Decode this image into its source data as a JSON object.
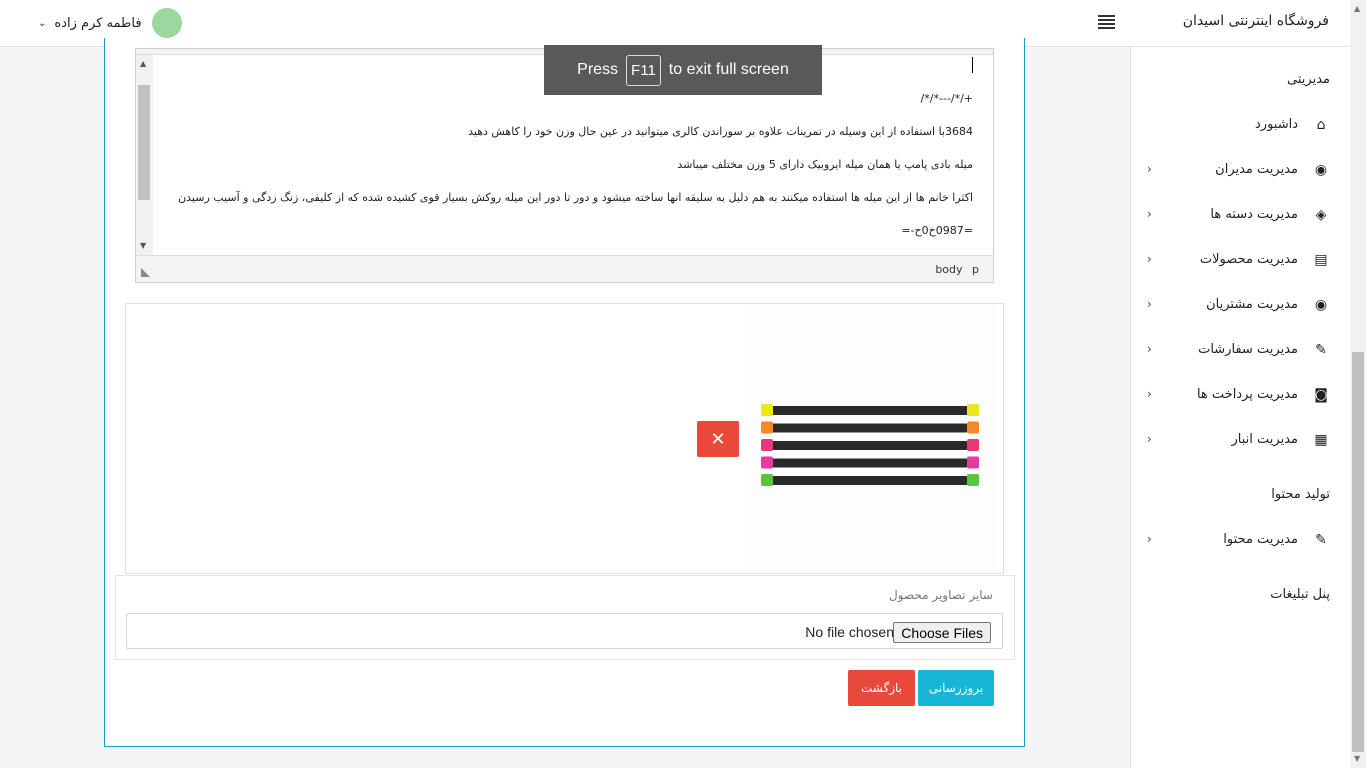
{
  "header": {
    "brand": "فروشگاه اینترنتی اسیدان",
    "user_name": "فاطمه کرم زاده",
    "user_chevron": "⌄"
  },
  "fullscreen_toast": {
    "press": "Press",
    "key": "F11",
    "rest": "to exit full screen"
  },
  "editor": {
    "lines": [
      "+/*/---*/*/",
      "3684با استفاده از این وسیله در تمرینات علاوه بر سوزاندن کالری میتوانید در عین حال وزن خود را کاهش دهید",
      "میله بادی پامپ یا همان میله ایروبیک دارای 5 وزن مختلف میباشد",
      "اکثرا خانم ها از این میله ها استفاده میکنند به هم دلیل به سلیقه انها ساخته میشود و دور تا دور این میله روکش بسیار قوی کشیده شده که از کلیفی، زنگ زدگی و آسیب رسیدن به محصول",
      "=0987خ0ح-="
    ],
    "status_path": "body p"
  },
  "image_preview": {
    "delete_glyph": "✕",
    "bar_colors": [
      "#e8e81a",
      "#f08a2a",
      "#e8387a",
      "#e43c9a",
      "#5bc43a"
    ]
  },
  "other_images": {
    "label": "سایر تصاویر محصول",
    "choose_button": "Choose Files",
    "no_file": "No file chosen"
  },
  "actions": {
    "update": "بروزرسانی",
    "back": "بازگشت"
  },
  "sidebar": {
    "section_admin": "مدیریتی",
    "section_content": "تولید محتوا",
    "ads_panel": "پنل تبلیغات",
    "items": [
      {
        "label": "داشبورد",
        "icon": "home-icon",
        "glyph": "⌂"
      },
      {
        "label": "مدیریت مدیران",
        "icon": "user-admin-icon",
        "glyph": "◉"
      },
      {
        "label": "مدیریت دسته ها",
        "icon": "layers-icon",
        "glyph": "◈"
      },
      {
        "label": "مدیریت محصولات",
        "icon": "clipboard-icon",
        "glyph": "▤"
      },
      {
        "label": "مدیریت مشتریان",
        "icon": "users-icon",
        "glyph": "◉"
      },
      {
        "label": "مدیریت سفارشات",
        "icon": "pencil-icon",
        "glyph": "✎"
      },
      {
        "label": "مدیریت پرداخت ها",
        "icon": "money-icon",
        "glyph": "◙"
      },
      {
        "label": "مدیریت انبار",
        "icon": "warehouse-icon",
        "glyph": "▦"
      },
      {
        "label": "مدیریت محتوا",
        "icon": "pencil-icon",
        "glyph": "✎"
      }
    ],
    "arrow_glyph": "‹"
  }
}
